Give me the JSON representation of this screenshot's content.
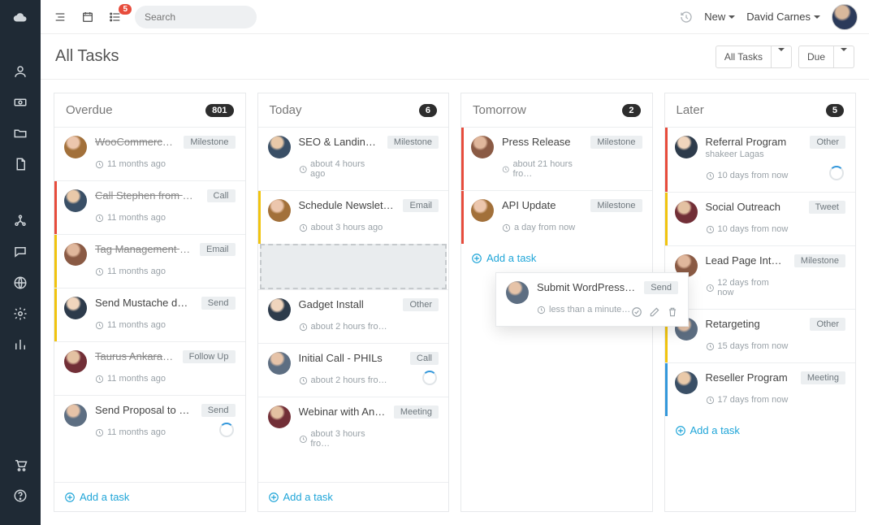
{
  "topbar": {
    "list_badge": "5",
    "search_placeholder": "Search",
    "new_label": "New",
    "user_name": "David Carnes"
  },
  "title": "All Tasks",
  "filters": {
    "scope_label": "All Tasks",
    "sort_label": "Due"
  },
  "columns": {
    "overdue": {
      "title": "Overdue",
      "count": "801",
      "add_label": "Add a task",
      "cards": [
        {
          "title": "WooCommerce Blog",
          "tag": "Milestone",
          "time": "11 months ago",
          "stripe": "",
          "done": true,
          "avatar": "av2"
        },
        {
          "title": "Call Stephen from Ge…",
          "tag": "Call",
          "time": "11 months ago",
          "stripe": "red",
          "done": true,
          "avatar": "av1"
        },
        {
          "title": "Tag Management Mail",
          "tag": "Email",
          "time": "11 months ago",
          "stripe": "yellow",
          "done": true,
          "avatar": "av6"
        },
        {
          "title": "Send Mustache docu…",
          "tag": "Send",
          "time": "11 months ago",
          "stripe": "yellow",
          "done": false,
          "avatar": "av4"
        },
        {
          "title": "Taurus Ankara - Foll…",
          "tag": "Follow Up",
          "time": "11 months ago",
          "stripe": "",
          "done": true,
          "avatar": "av3"
        },
        {
          "title": "Send Proposal to Mo…",
          "tag": "Send",
          "time": "11 months ago",
          "stripe": "",
          "done": false,
          "avatar": "av5",
          "spinner": true
        }
      ]
    },
    "today": {
      "title": "Today",
      "count": "6",
      "add_label": "Add a task",
      "cards_top": [
        {
          "title": "SEO & Landing page",
          "tag": "Milestone",
          "time": "about 4 hours ago",
          "stripe": "",
          "avatar": "av1"
        },
        {
          "title": "Schedule Newsletter",
          "tag": "Email",
          "time": "about 3 hours ago",
          "stripe": "yellow",
          "avatar": "av2"
        }
      ],
      "cards_bottom": [
        {
          "title": "Gadget Install",
          "tag": "Other",
          "time": "about 2 hours fro…",
          "stripe": "",
          "avatar": "av4"
        },
        {
          "title": "Initial Call - PHILs",
          "tag": "Call",
          "time": "about 2 hours fro…",
          "stripe": "",
          "avatar": "av5",
          "spinner": true
        },
        {
          "title": "Webinar with Andrea",
          "tag": "Meeting",
          "time": "about 3 hours fro…",
          "stripe": "",
          "avatar": "av3"
        }
      ]
    },
    "tomorrow": {
      "title": "Tomorrow",
      "count": "2",
      "add_label": "Add a task",
      "cards": [
        {
          "title": "Press Release",
          "tag": "Milestone",
          "time": "about 21 hours fro…",
          "stripe": "red",
          "avatar": "av6"
        },
        {
          "title": "API Update",
          "tag": "Milestone",
          "time": "a day from now",
          "stripe": "red",
          "avatar": "av2"
        }
      ]
    },
    "later": {
      "title": "Later",
      "count": "5",
      "add_label": "Add a task",
      "cards": [
        {
          "title": "Referral Program",
          "sub": "shakeer Lagas",
          "tag": "Other",
          "time": "10 days from now",
          "stripe": "red",
          "avatar": "av4",
          "spinner": true
        },
        {
          "title": "Social Outreach",
          "tag": "Tweet",
          "time": "10 days from now",
          "stripe": "yellow",
          "avatar": "av3"
        },
        {
          "title": "Lead Page Integration",
          "tag": "Milestone",
          "time": "12 days from now",
          "stripe": "",
          "avatar": "av6"
        },
        {
          "title": "Retargeting",
          "tag": "Other",
          "time": "15 days from now",
          "stripe": "yellow",
          "avatar": "av5"
        },
        {
          "title": "Reseller Program",
          "tag": "Meeting",
          "time": "17 days from now",
          "stripe": "blue",
          "avatar": "av1"
        }
      ]
    }
  },
  "dragged_card": {
    "title": "Submit WordPress Pl…",
    "tag": "Send",
    "time": "less than a minute…"
  }
}
